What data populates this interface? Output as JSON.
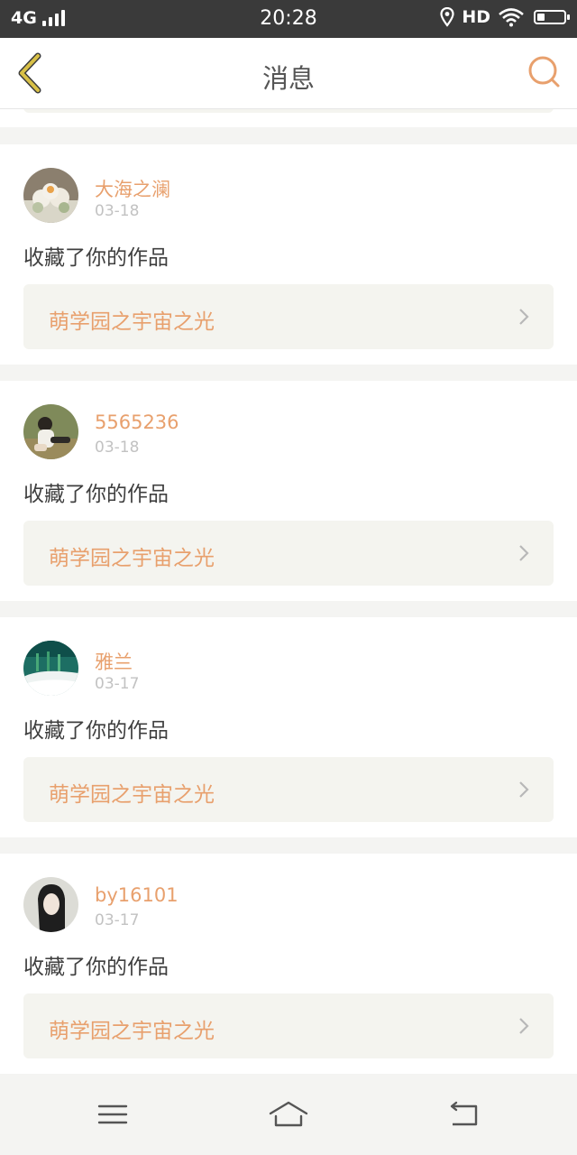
{
  "status_bar": {
    "network": "4G",
    "time": "20:28",
    "hd": "HD",
    "icons": [
      "signal-icon",
      "location-icon",
      "wifi-icon",
      "battery-icon"
    ]
  },
  "nav": {
    "title": "消息",
    "back_icon": "chevron-left-icon",
    "search_icon": "search-icon"
  },
  "colors": {
    "accent": "#e8a06d",
    "back_icon": "#c9b038",
    "status_bar_bg": "#3a3a3a",
    "card_inner_bg": "#f4f4ef"
  },
  "messages": [
    {
      "user": "大海之澜",
      "date": "03-18",
      "action": "收藏了你的作品",
      "work": "萌学园之宇宙之光",
      "avatar": "flower"
    },
    {
      "user": "5565236",
      "date": "03-18",
      "action": "收藏了你的作品",
      "work": "萌学园之宇宙之光",
      "avatar": "girl-sitting"
    },
    {
      "user": "雅兰",
      "date": "03-17",
      "action": "收藏了你的作品",
      "work": "萌学园之宇宙之光",
      "avatar": "teal-landscape"
    },
    {
      "user": "by16101",
      "date": "03-17",
      "action": "收藏了你的作品",
      "work": "萌学园之宇宙之光",
      "avatar": "girl-portrait"
    }
  ],
  "bottom_nav": {
    "icons": [
      "menu-icon",
      "home-icon",
      "back-icon"
    ]
  }
}
